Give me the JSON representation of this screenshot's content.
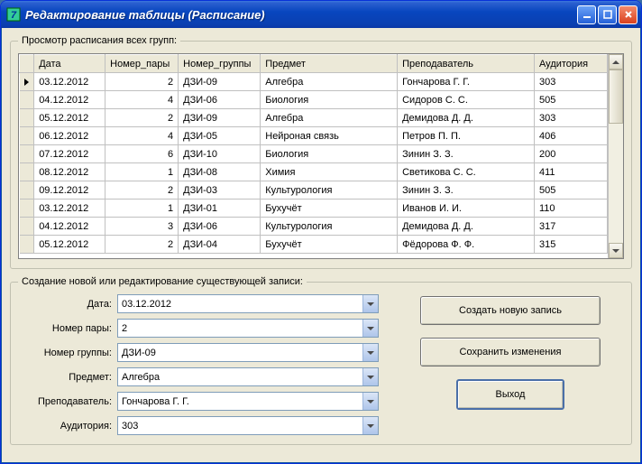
{
  "window": {
    "title": "Редактирование таблицы (Расписание)"
  },
  "groupbox_top": {
    "legend": "Просмотр расписания всех групп:"
  },
  "grid": {
    "columns": [
      "Дата",
      "Номер_пары",
      "Номер_группы",
      "Предмет",
      "Преподаватель",
      "Аудитория"
    ],
    "rows": [
      {
        "date": "03.12.2012",
        "pair": "2",
        "group": "ДЗИ-09",
        "subj": "Алгебра",
        "teacher": "Гончарова Г. Г.",
        "room": "303"
      },
      {
        "date": "04.12.2012",
        "pair": "4",
        "group": "ДЗИ-06",
        "subj": "Биология",
        "teacher": "Сидоров С. С.",
        "room": "505"
      },
      {
        "date": "05.12.2012",
        "pair": "2",
        "group": "ДЗИ-09",
        "subj": "Алгебра",
        "teacher": "Демидова Д. Д.",
        "room": "303"
      },
      {
        "date": "06.12.2012",
        "pair": "4",
        "group": "ДЗИ-05",
        "subj": "Нейроная связь",
        "teacher": "Петров П. П.",
        "room": "406"
      },
      {
        "date": "07.12.2012",
        "pair": "6",
        "group": "ДЗИ-10",
        "subj": "Биология",
        "teacher": "Зинин З. З.",
        "room": "200"
      },
      {
        "date": "08.12.2012",
        "pair": "1",
        "group": "ДЗИ-08",
        "subj": "Химия",
        "teacher": "Светикова С. С.",
        "room": "411"
      },
      {
        "date": "09.12.2012",
        "pair": "2",
        "group": "ДЗИ-03",
        "subj": "Культурология",
        "teacher": "Зинин З. З.",
        "room": "505"
      },
      {
        "date": "03.12.2012",
        "pair": "1",
        "group": "ДЗИ-01",
        "subj": "Бухучёт",
        "teacher": "Иванов И. И.",
        "room": "110"
      },
      {
        "date": "04.12.2012",
        "pair": "3",
        "group": "ДЗИ-06",
        "subj": "Культурология",
        "teacher": "Демидова Д. Д.",
        "room": "317"
      },
      {
        "date": "05.12.2012",
        "pair": "2",
        "group": "ДЗИ-04",
        "subj": "Бухучёт",
        "teacher": "Фёдорова Ф. Ф.",
        "room": "315"
      }
    ]
  },
  "groupbox_bottom": {
    "legend": "Создание новой или редактирование существующей записи:"
  },
  "form": {
    "labels": {
      "date": "Дата:",
      "pair": "Номер пары:",
      "group": "Номер группы:",
      "subj": "Предмет:",
      "teacher": "Преподаватель:",
      "room": "Аудитория:"
    },
    "values": {
      "date": "03.12.2012",
      "pair": "2",
      "group": "ДЗИ-09",
      "subj": "Алгебра",
      "teacher": "Гончарова Г. Г.",
      "room": "303"
    }
  },
  "buttons": {
    "create": "Создать новую запись",
    "save": "Сохранить изменения",
    "exit": "Выход"
  }
}
